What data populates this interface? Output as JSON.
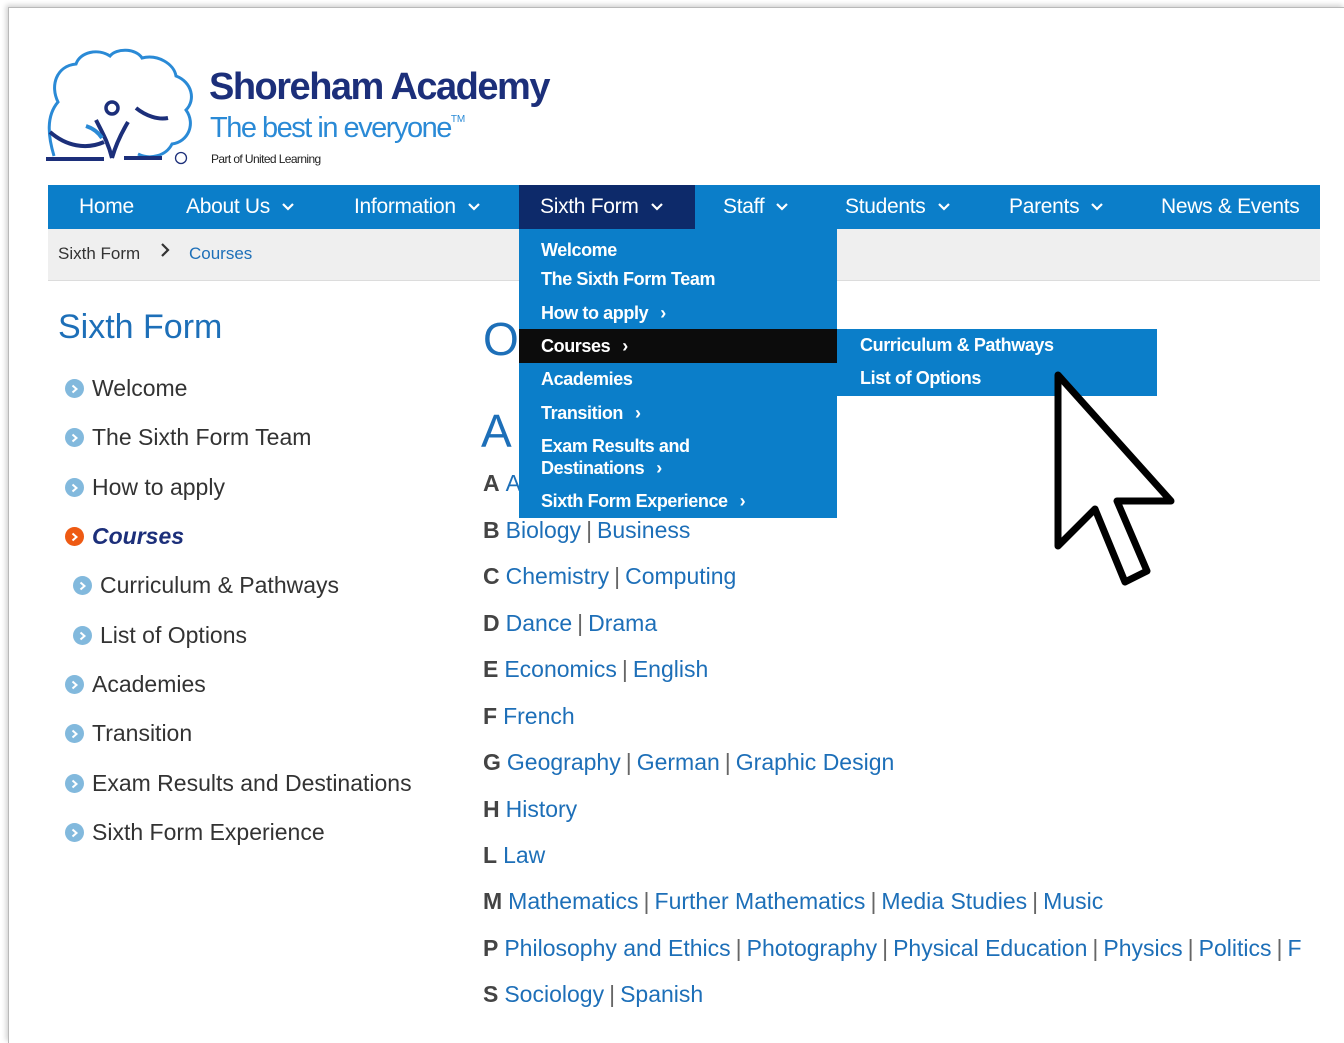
{
  "brand": {
    "name": "Shoreham Academy",
    "tagline": "The best in everyone",
    "tagline_mark": "TM",
    "registered_mark": "®",
    "sub": "Part of United Learning"
  },
  "nav": {
    "items": [
      {
        "label": "Home",
        "has_dropdown": false
      },
      {
        "label": "About Us",
        "has_dropdown": true
      },
      {
        "label": "Information",
        "has_dropdown": true
      },
      {
        "label": "Sixth Form",
        "has_dropdown": true,
        "active": true
      },
      {
        "label": "Staff",
        "has_dropdown": true
      },
      {
        "label": "Students",
        "has_dropdown": true
      },
      {
        "label": "Parents",
        "has_dropdown": true
      },
      {
        "label": "News & Events",
        "has_dropdown": false
      }
    ]
  },
  "breadcrumb": {
    "home": "Sixth Form",
    "separator": ">",
    "current": "Courses"
  },
  "dropdown": {
    "items": [
      {
        "label": "Welcome"
      },
      {
        "label": "The Sixth Form Team"
      },
      {
        "label": "How to apply",
        "arrow": "›"
      },
      {
        "label": "Courses",
        "arrow": "›",
        "active": true
      },
      {
        "label": "Academies"
      },
      {
        "label": "Transition",
        "arrow": "›"
      },
      {
        "label_line1": "Exam Results and",
        "label_line2": "Destinations",
        "arrow": "›"
      },
      {
        "label": "Sixth Form Experience",
        "arrow": "›"
      }
    ],
    "flyout": [
      "Curriculum & Pathways",
      "List of Options"
    ]
  },
  "sidebar": {
    "title": "Sixth Form",
    "items": [
      {
        "label": "Welcome"
      },
      {
        "label": "The Sixth Form Team"
      },
      {
        "label": "How to apply"
      },
      {
        "label": "Courses",
        "current": true
      },
      {
        "label": "Curriculum & Pathways",
        "indent": true
      },
      {
        "label": "List of Options",
        "indent": true
      },
      {
        "label": "Academies"
      },
      {
        "label": "Transition"
      },
      {
        "label": "Exam Results and Destinations"
      },
      {
        "label": "Sixth Form Experience"
      }
    ]
  },
  "main": {
    "heading_partial": "O",
    "section_letter": "A",
    "first_row_partial": {
      "letter": "A",
      "subject": "A"
    },
    "rows": [
      {
        "letter": "B",
        "subjects": [
          "Biology",
          "Business"
        ]
      },
      {
        "letter": "C",
        "subjects": [
          "Chemistry",
          "Computing"
        ]
      },
      {
        "letter": "D",
        "subjects": [
          "Dance",
          "Drama"
        ]
      },
      {
        "letter": "E",
        "subjects": [
          "Economics",
          "English"
        ]
      },
      {
        "letter": "F",
        "subjects": [
          "French"
        ]
      },
      {
        "letter": "G",
        "subjects": [
          "Geography",
          "German",
          "Graphic Design"
        ]
      },
      {
        "letter": "H",
        "subjects": [
          "History"
        ]
      },
      {
        "letter": "L",
        "subjects": [
          "Law"
        ]
      },
      {
        "letter": "M",
        "subjects": [
          "Mathematics",
          "Further Mathematics",
          "Media Studies",
          "Music"
        ]
      },
      {
        "letter": "P",
        "subjects": [
          "Philosophy and Ethics",
          "Photography",
          "Physical Education",
          "Physics",
          "Politics",
          "F"
        ]
      },
      {
        "letter": "S",
        "subjects": [
          "Sociology",
          "Spanish"
        ]
      }
    ]
  },
  "colors": {
    "nav_blue": "#0b7ec9",
    "nav_active": "#0d2a6a",
    "link_blue": "#1d6fb8",
    "brand_navy": "#1c2f7a",
    "current_bullet": "#ee5a13"
  }
}
